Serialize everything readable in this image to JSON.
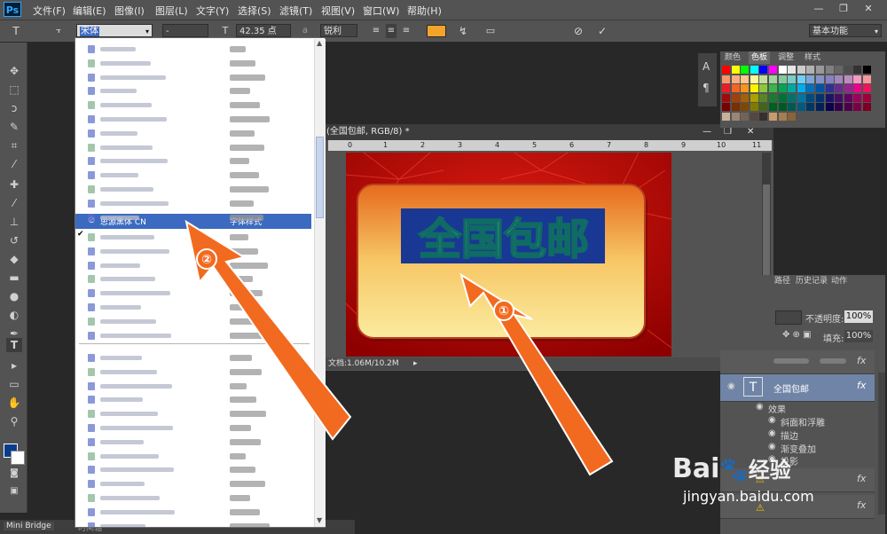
{
  "app": {
    "logo": "Ps"
  },
  "menu": [
    "文件(F)",
    "编辑(E)",
    "图像(I)",
    "图层(L)",
    "文字(Y)",
    "选择(S)",
    "滤镜(T)",
    "视图(V)",
    "窗口(W)",
    "帮助(H)"
  ],
  "window_buttons": {
    "minimize": "—",
    "restore": "❐",
    "close": "✕"
  },
  "options": {
    "font_family": "宋体",
    "font_style": "-",
    "font_size": "42.35 点",
    "aa_label": "a",
    "antialias": "锐利",
    "color": "#f3a429",
    "workspace": "基本功能"
  },
  "font_list": {
    "selected_font": "思源黑体 CN",
    "selected_sample": "字体样式"
  },
  "document": {
    "title": "(全国包邮, RGB/8) *",
    "ruler_ticks": [
      "0",
      "1",
      "2",
      "3",
      "4",
      "5",
      "6",
      "7",
      "8",
      "9",
      "10",
      "11"
    ],
    "status": "文档:1.06M/10.2M",
    "canvas_text": "全国包邮"
  },
  "swatches_panel": {
    "tabs": [
      "颜色",
      "色板",
      "调整",
      "样式"
    ]
  },
  "layers_panel": {
    "tabs": [
      "路径",
      "历史记录",
      "动作"
    ],
    "opacity_label": "不透明度:",
    "opacity_value": "100%",
    "fill_label": "填充:",
    "fill_value": "100%",
    "text_layer": "全国包邮",
    "effects_label": "效果",
    "effects": [
      "斜面和浮雕",
      "描边",
      "渐变叠加",
      "投影"
    ]
  },
  "bottom_tabs": [
    "Mini Bridge",
    "时间轴"
  ],
  "markers": [
    "①",
    "②"
  ],
  "watermark": {
    "brand": "Bai",
    "brand2": "经验",
    "url": "jingyan.baidu.com"
  }
}
